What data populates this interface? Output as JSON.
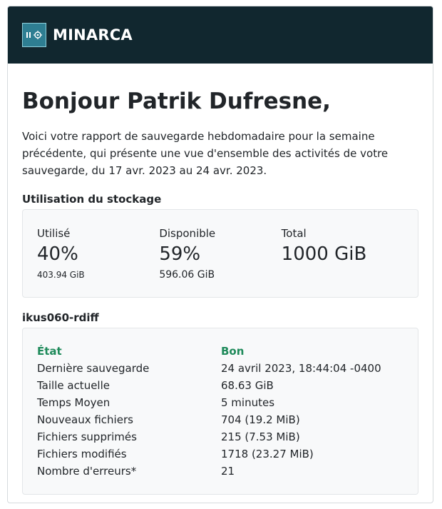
{
  "brand": {
    "name": "MINARCA",
    "logo_icon": "minarca-safe-icon",
    "header_color": "#11272f"
  },
  "greeting": "Bonjour Patrik Dufresne,",
  "intro": "Voici votre rapport de sauvegarde hebdomadaire pour la semaine précédente, qui présente une vue d'ensemble des activités de votre sauvegarde, du 17 avr. 2023 au 24 avr. 2023.",
  "storage": {
    "title": "Utilisation du stockage",
    "used": {
      "label": "Utilisé",
      "percent": "40%",
      "amount": "403.94 GiB"
    },
    "available": {
      "label": "Disponible",
      "percent": "59%",
      "amount": "596.06 GiB"
    },
    "total": {
      "label": "Total",
      "amount": "1000 GiB"
    }
  },
  "repository": {
    "name": "ikus060-rdiff",
    "status_color": "#1e8a5a",
    "rows": [
      {
        "key": "État",
        "value": "Bon"
      },
      {
        "key": "Dernière sauvegarde",
        "value": "24 avril 2023, 18:44:04 -0400"
      },
      {
        "key": "Taille actuelle",
        "value": "68.63 GiB"
      },
      {
        "key": "Temps Moyen",
        "value": "5 minutes"
      },
      {
        "key": "Nouveaux fichiers",
        "value": "704 (19.2 MiB)"
      },
      {
        "key": "Fichiers supprimés",
        "value": "215 (7.53 MiB)"
      },
      {
        "key": "Fichiers modifiés",
        "value": "1718 (23.27 MiB)"
      },
      {
        "key": "Nombre d'erreurs*",
        "value": "21"
      }
    ]
  }
}
